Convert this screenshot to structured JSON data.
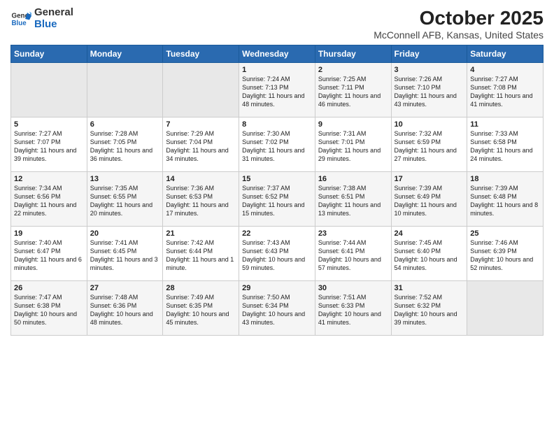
{
  "header": {
    "logo_general": "General",
    "logo_blue": "Blue",
    "month": "October 2025",
    "location": "McConnell AFB, Kansas, United States"
  },
  "days_of_week": [
    "Sunday",
    "Monday",
    "Tuesday",
    "Wednesday",
    "Thursday",
    "Friday",
    "Saturday"
  ],
  "weeks": [
    [
      {
        "day": "",
        "info": ""
      },
      {
        "day": "",
        "info": ""
      },
      {
        "day": "",
        "info": ""
      },
      {
        "day": "1",
        "info": "Sunrise: 7:24 AM\nSunset: 7:13 PM\nDaylight: 11 hours\nand 48 minutes."
      },
      {
        "day": "2",
        "info": "Sunrise: 7:25 AM\nSunset: 7:11 PM\nDaylight: 11 hours\nand 46 minutes."
      },
      {
        "day": "3",
        "info": "Sunrise: 7:26 AM\nSunset: 7:10 PM\nDaylight: 11 hours\nand 43 minutes."
      },
      {
        "day": "4",
        "info": "Sunrise: 7:27 AM\nSunset: 7:08 PM\nDaylight: 11 hours\nand 41 minutes."
      }
    ],
    [
      {
        "day": "5",
        "info": "Sunrise: 7:27 AM\nSunset: 7:07 PM\nDaylight: 11 hours\nand 39 minutes."
      },
      {
        "day": "6",
        "info": "Sunrise: 7:28 AM\nSunset: 7:05 PM\nDaylight: 11 hours\nand 36 minutes."
      },
      {
        "day": "7",
        "info": "Sunrise: 7:29 AM\nSunset: 7:04 PM\nDaylight: 11 hours\nand 34 minutes."
      },
      {
        "day": "8",
        "info": "Sunrise: 7:30 AM\nSunset: 7:02 PM\nDaylight: 11 hours\nand 31 minutes."
      },
      {
        "day": "9",
        "info": "Sunrise: 7:31 AM\nSunset: 7:01 PM\nDaylight: 11 hours\nand 29 minutes."
      },
      {
        "day": "10",
        "info": "Sunrise: 7:32 AM\nSunset: 6:59 PM\nDaylight: 11 hours\nand 27 minutes."
      },
      {
        "day": "11",
        "info": "Sunrise: 7:33 AM\nSunset: 6:58 PM\nDaylight: 11 hours\nand 24 minutes."
      }
    ],
    [
      {
        "day": "12",
        "info": "Sunrise: 7:34 AM\nSunset: 6:56 PM\nDaylight: 11 hours\nand 22 minutes."
      },
      {
        "day": "13",
        "info": "Sunrise: 7:35 AM\nSunset: 6:55 PM\nDaylight: 11 hours\nand 20 minutes."
      },
      {
        "day": "14",
        "info": "Sunrise: 7:36 AM\nSunset: 6:53 PM\nDaylight: 11 hours\nand 17 minutes."
      },
      {
        "day": "15",
        "info": "Sunrise: 7:37 AM\nSunset: 6:52 PM\nDaylight: 11 hours\nand 15 minutes."
      },
      {
        "day": "16",
        "info": "Sunrise: 7:38 AM\nSunset: 6:51 PM\nDaylight: 11 hours\nand 13 minutes."
      },
      {
        "day": "17",
        "info": "Sunrise: 7:39 AM\nSunset: 6:49 PM\nDaylight: 11 hours\nand 10 minutes."
      },
      {
        "day": "18",
        "info": "Sunrise: 7:39 AM\nSunset: 6:48 PM\nDaylight: 11 hours\nand 8 minutes."
      }
    ],
    [
      {
        "day": "19",
        "info": "Sunrise: 7:40 AM\nSunset: 6:47 PM\nDaylight: 11 hours\nand 6 minutes."
      },
      {
        "day": "20",
        "info": "Sunrise: 7:41 AM\nSunset: 6:45 PM\nDaylight: 11 hours\nand 3 minutes."
      },
      {
        "day": "21",
        "info": "Sunrise: 7:42 AM\nSunset: 6:44 PM\nDaylight: 11 hours\nand 1 minute."
      },
      {
        "day": "22",
        "info": "Sunrise: 7:43 AM\nSunset: 6:43 PM\nDaylight: 10 hours\nand 59 minutes."
      },
      {
        "day": "23",
        "info": "Sunrise: 7:44 AM\nSunset: 6:41 PM\nDaylight: 10 hours\nand 57 minutes."
      },
      {
        "day": "24",
        "info": "Sunrise: 7:45 AM\nSunset: 6:40 PM\nDaylight: 10 hours\nand 54 minutes."
      },
      {
        "day": "25",
        "info": "Sunrise: 7:46 AM\nSunset: 6:39 PM\nDaylight: 10 hours\nand 52 minutes."
      }
    ],
    [
      {
        "day": "26",
        "info": "Sunrise: 7:47 AM\nSunset: 6:38 PM\nDaylight: 10 hours\nand 50 minutes."
      },
      {
        "day": "27",
        "info": "Sunrise: 7:48 AM\nSunset: 6:36 PM\nDaylight: 10 hours\nand 48 minutes."
      },
      {
        "day": "28",
        "info": "Sunrise: 7:49 AM\nSunset: 6:35 PM\nDaylight: 10 hours\nand 45 minutes."
      },
      {
        "day": "29",
        "info": "Sunrise: 7:50 AM\nSunset: 6:34 PM\nDaylight: 10 hours\nand 43 minutes."
      },
      {
        "day": "30",
        "info": "Sunrise: 7:51 AM\nSunset: 6:33 PM\nDaylight: 10 hours\nand 41 minutes."
      },
      {
        "day": "31",
        "info": "Sunrise: 7:52 AM\nSunset: 6:32 PM\nDaylight: 10 hours\nand 39 minutes."
      },
      {
        "day": "",
        "info": ""
      }
    ]
  ]
}
